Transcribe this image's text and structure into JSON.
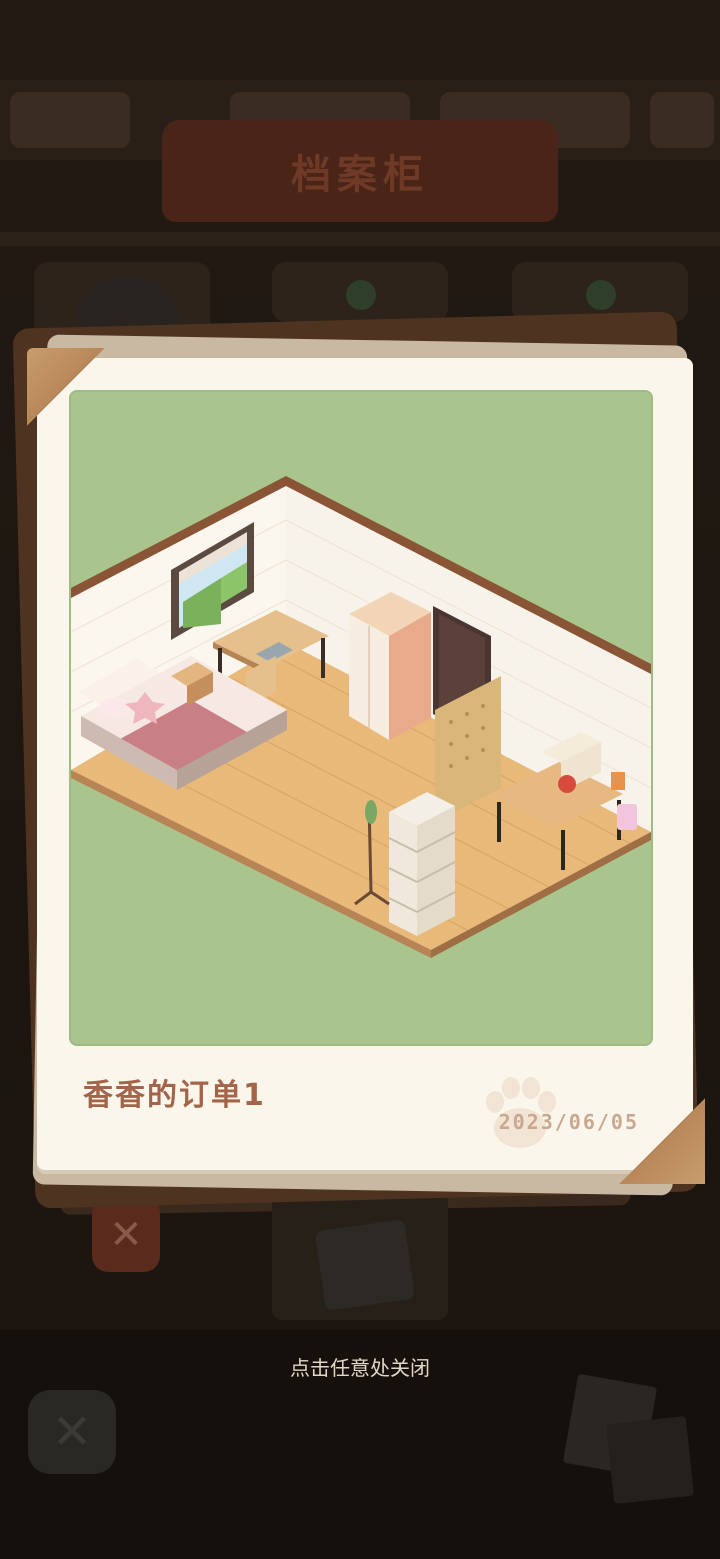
{
  "background": {
    "sign_title": "档案柜",
    "close_icon": "close-icon",
    "bottom_close_icon": "close-icon"
  },
  "photo": {
    "title": "香香的订单1",
    "date": "2023/06/05",
    "image_subject": "isometric bedroom"
  },
  "hint": {
    "text": "点击任意处关闭"
  },
  "colors": {
    "photo_bg": "#a9c58d",
    "card_bg": "#fbf6ec",
    "title_color": "#a3654a",
    "date_color": "#c9a890"
  }
}
